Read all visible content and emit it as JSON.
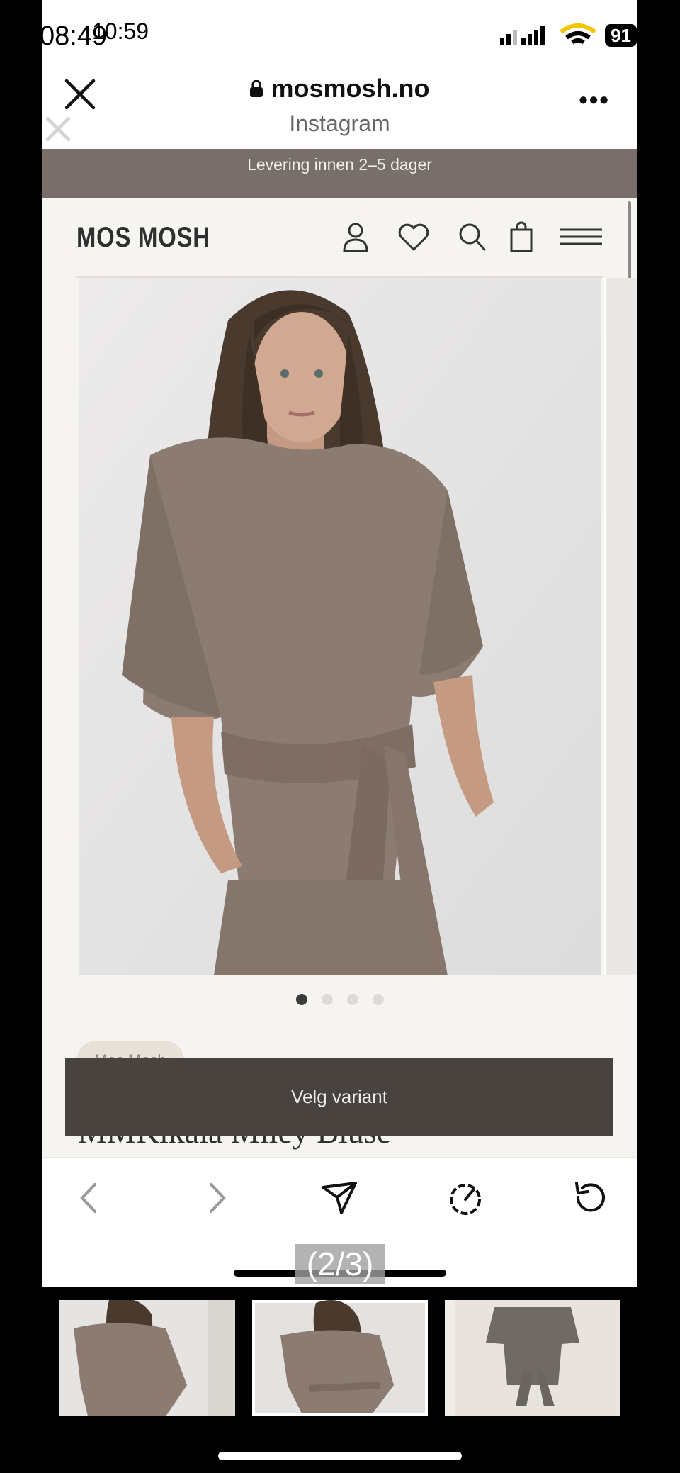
{
  "status_bar": {
    "time": "08:49",
    "time_overlay": "10:59",
    "battery": "91"
  },
  "browser": {
    "url": "mosmosh.no",
    "source": "Instagram",
    "more": "•••"
  },
  "site": {
    "banner": "Levering innen 2–5 dager",
    "logo": "MOS MOSH",
    "brand_pill": "Mos Mosh",
    "product_title": "MMKikala Miley Bluse",
    "cta": "Velg variant",
    "carousel_dots": 4,
    "carousel_active": 1
  },
  "viewer": {
    "counter": "(2/3)"
  },
  "colors": {
    "banner_bg": "#786f6a",
    "site_bg": "#f6f4f0",
    "cta_bg": "#48433f",
    "garment": "#8b7b70"
  }
}
